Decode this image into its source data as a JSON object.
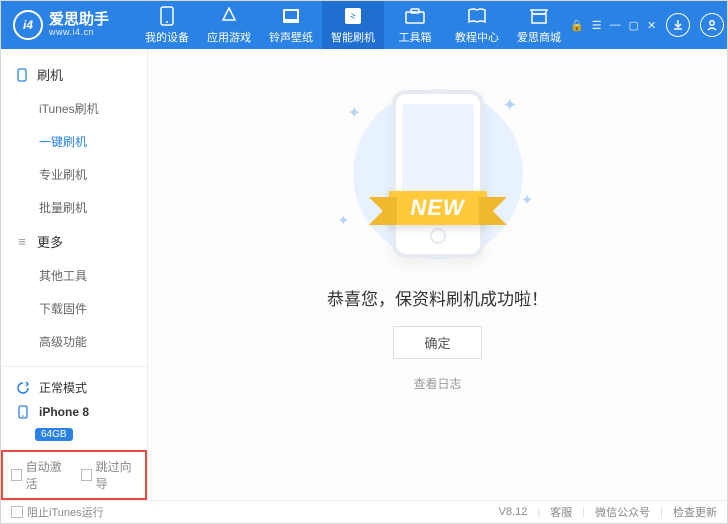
{
  "logo": {
    "badge": "i4",
    "cn": "爱思助手",
    "en": "www.i4.cn"
  },
  "nav": {
    "items": [
      {
        "label": "我的设备"
      },
      {
        "label": "应用游戏"
      },
      {
        "label": "铃声壁纸"
      },
      {
        "label": "智能刷机"
      },
      {
        "label": "工具箱"
      },
      {
        "label": "教程中心"
      },
      {
        "label": "爱思商城"
      }
    ]
  },
  "sidebar": {
    "section1": {
      "title": "刷机",
      "items": [
        "iTunes刷机",
        "一键刷机",
        "专业刷机",
        "批量刷机"
      ]
    },
    "section2": {
      "title": "更多",
      "items": [
        "其他工具",
        "下载固件",
        "高级功能"
      ]
    },
    "mode": "正常模式",
    "device": "iPhone 8",
    "storage": "64GB",
    "check1": "自动激活",
    "check2": "跳过向导"
  },
  "main": {
    "ribbon": "NEW",
    "message": "恭喜您，保资料刷机成功啦！",
    "ok": "确定",
    "log": "查看日志"
  },
  "footer": {
    "block_itunes": "阻止iTunes运行",
    "version": "V8.12",
    "support": "客服",
    "wechat": "微信公众号",
    "update": "检查更新"
  }
}
